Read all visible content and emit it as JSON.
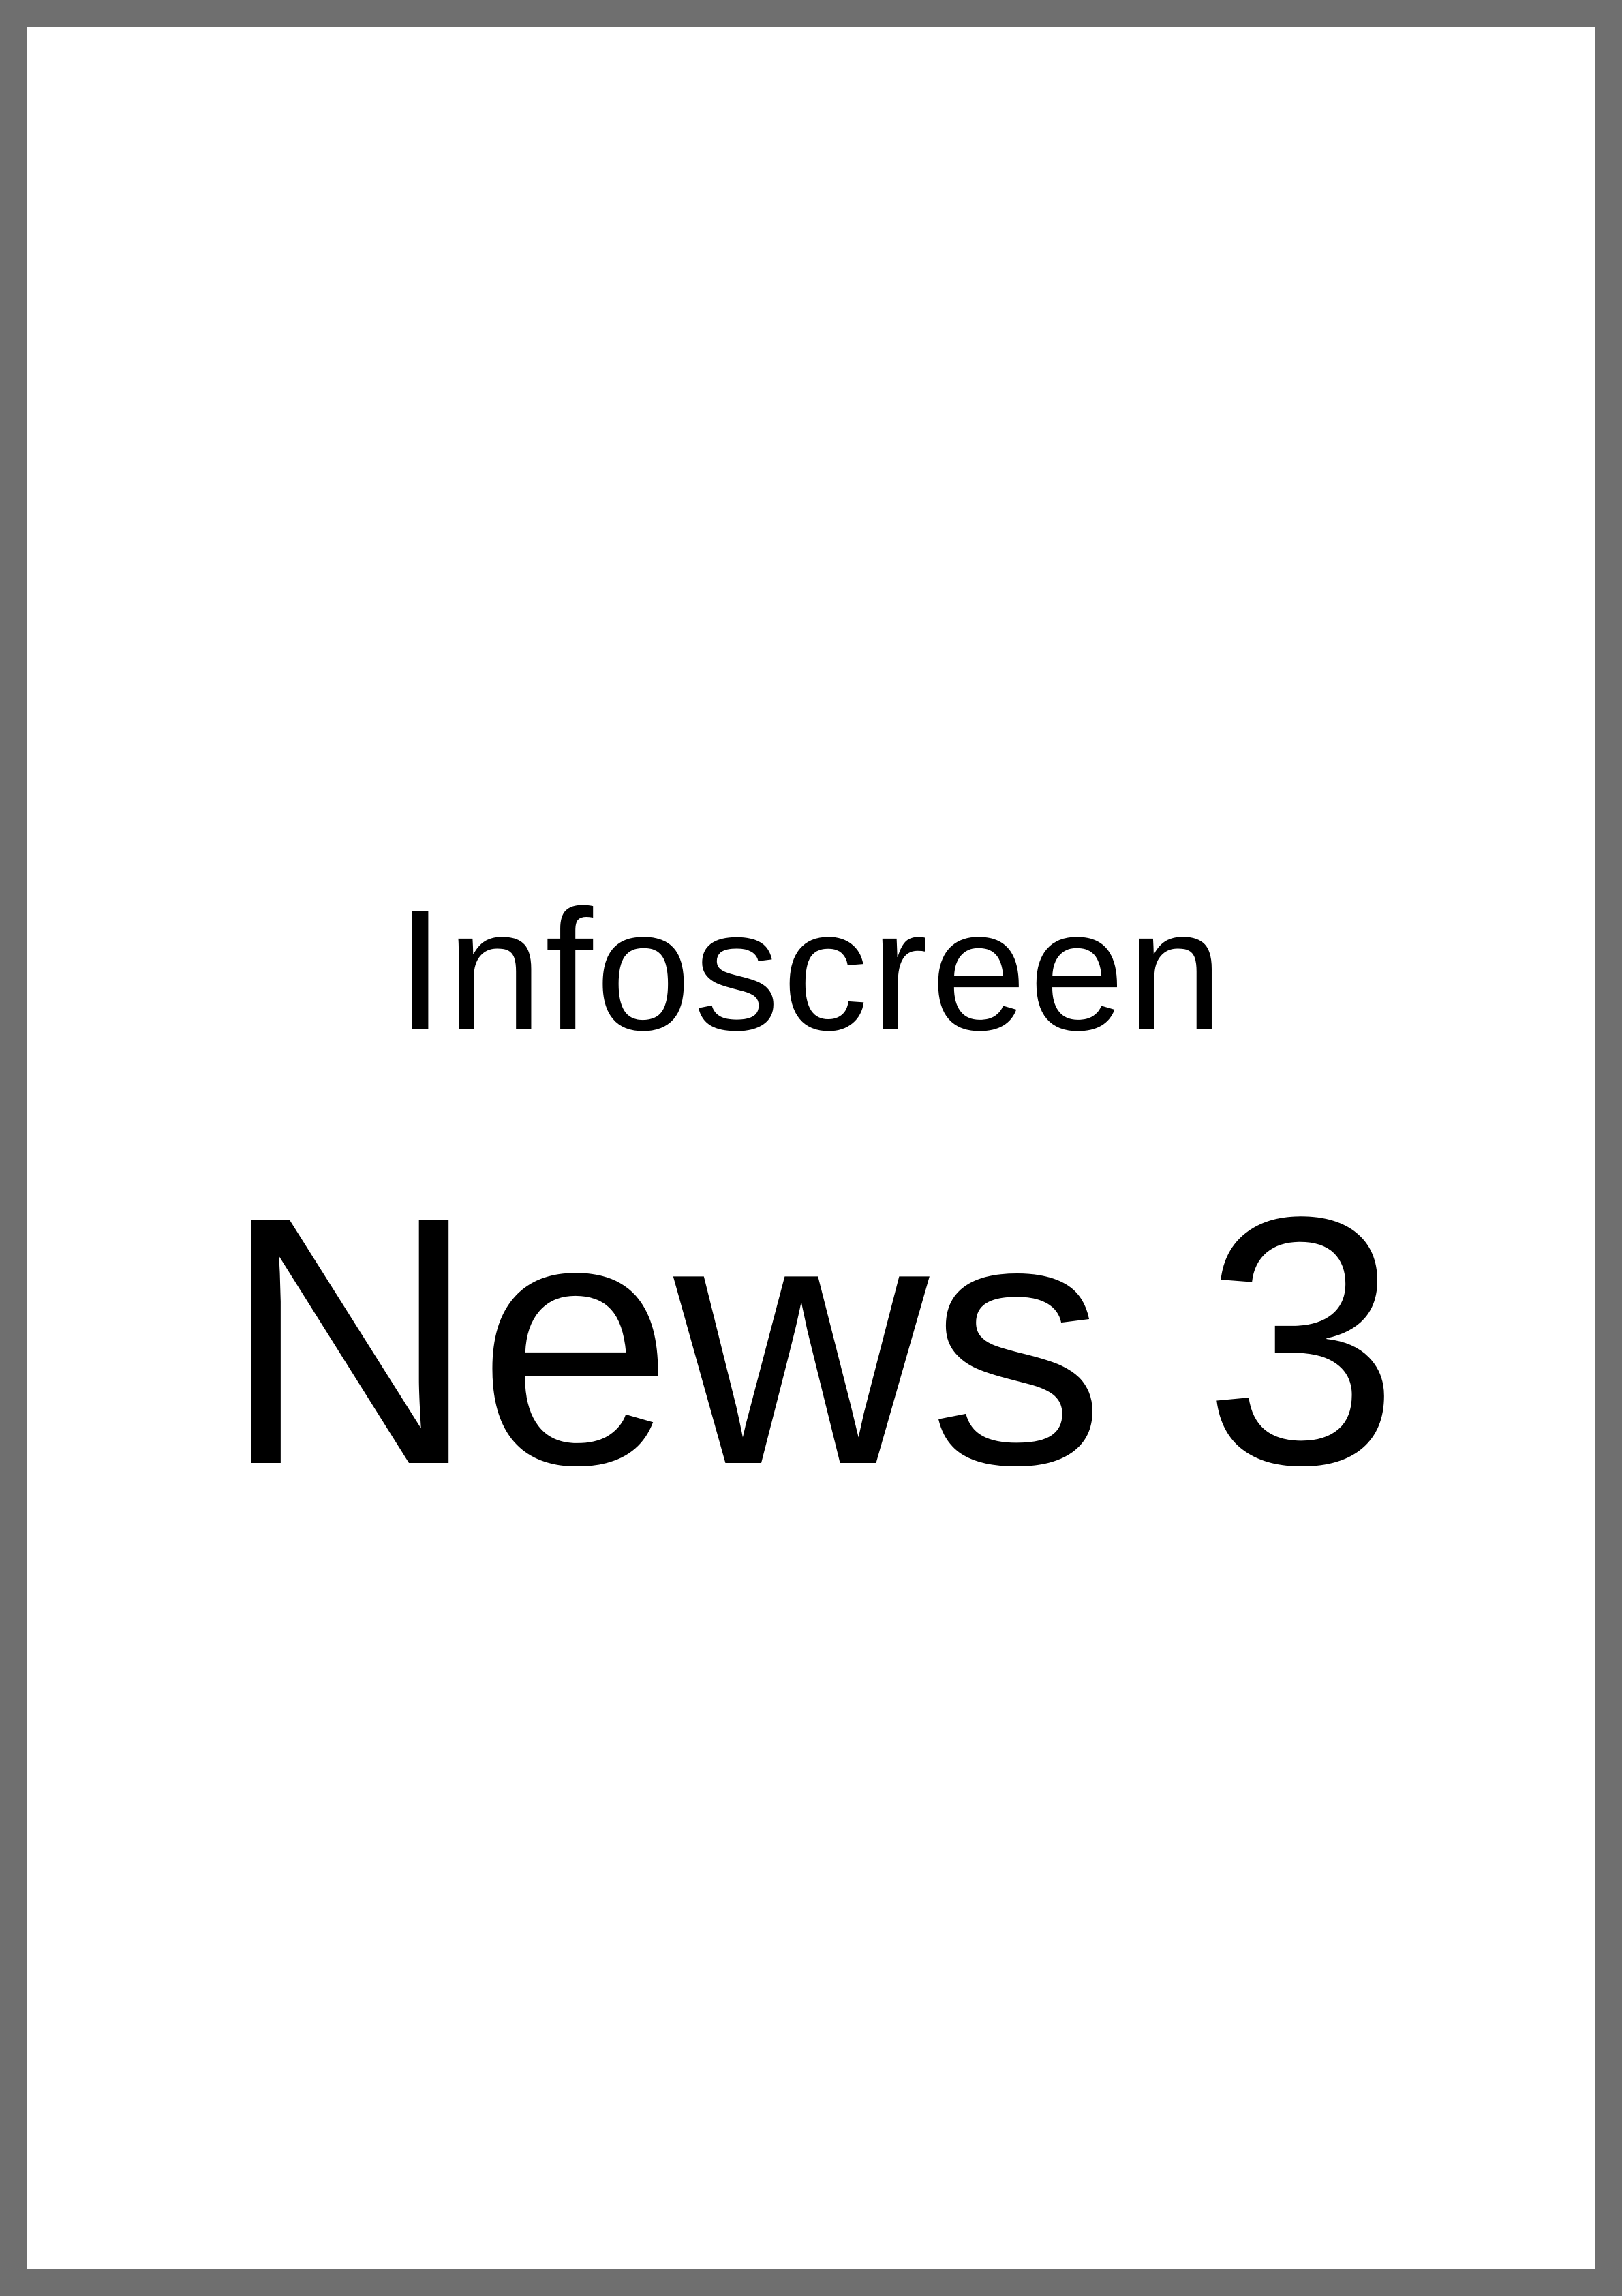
{
  "screen": {
    "subtitle": "Infoscreen",
    "title": "News 3",
    "colors": {
      "border": "#6f6f6f",
      "background": "#ffffff",
      "text": "#000000"
    }
  }
}
